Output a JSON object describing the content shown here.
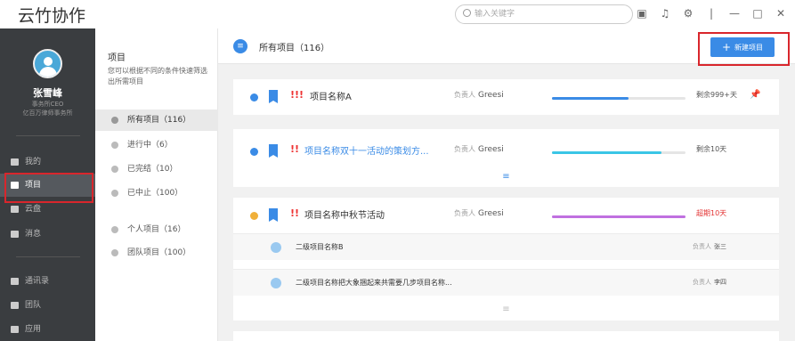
{
  "app": {
    "title": "云竹协作"
  },
  "search": {
    "placeholder": "输入关键字"
  },
  "titlebar_icons": [
    "building-icon",
    "bell-icon",
    "gear-icon",
    "minimize-icon",
    "maximize-icon",
    "close-icon"
  ],
  "user": {
    "name": "张雪峰",
    "role": "事务所CEO",
    "org": "亿百万律师事务所"
  },
  "sidebar": {
    "items": [
      {
        "label": "我的",
        "icon": "person-icon"
      },
      {
        "label": "项目",
        "icon": "project-icon",
        "active": true
      },
      {
        "label": "云盘",
        "icon": "cloud-icon"
      },
      {
        "label": "消息",
        "icon": "message-icon"
      },
      {
        "label": "通讯录",
        "icon": "contacts-icon"
      },
      {
        "label": "团队",
        "icon": "team-icon"
      },
      {
        "label": "应用",
        "icon": "apps-icon"
      }
    ]
  },
  "filter": {
    "title": "项目",
    "desc": "您可以根据不同的条件快速筛选出所需项目",
    "items": [
      {
        "label": "所有项目（116）",
        "active": true
      },
      {
        "label": "进行中（6）"
      },
      {
        "label": "已完结（10）"
      },
      {
        "label": "已中止（100）"
      },
      {
        "label": "个人项目（16）"
      },
      {
        "label": "团队项目（100）"
      }
    ]
  },
  "main": {
    "title": "所有项目（116）",
    "new_button": "新建项目",
    "projects": [
      {
        "priority": "!!!",
        "name": "项目名称A",
        "owner_label": "负责人",
        "owner": "Greesi",
        "progress": 0.57,
        "remain": "剩余999+天",
        "status_color": "#3a8be6",
        "bar_color": "#3a8be6",
        "remain_color": "#555555"
      },
      {
        "priority": "!!",
        "name": "项目名称双十一活动的策划方...",
        "owner_label": "负责人",
        "owner": "Greesi",
        "progress": 0.82,
        "remain": "剩余10天",
        "status_color": "#3a8be6",
        "bar_color": "#3ac6e6",
        "remain_color": "#555555"
      },
      {
        "priority": "!!",
        "name": "项目名称中秋节活动",
        "owner_label": "负责人",
        "owner": "Greesi",
        "progress": 1.0,
        "remain": "超期10天",
        "status_color": "#f0b03a",
        "bar_color": "#c070e0",
        "remain_color": "#e33333"
      }
    ],
    "subprojects": [
      {
        "name": "二级项目名称B",
        "owner_label": "负责人",
        "owner": "张三"
      },
      {
        "name": "二级项目名称把大象捆起来共需要几步项目名称...",
        "owner_label": "负责人",
        "owner": "李四"
      }
    ]
  }
}
